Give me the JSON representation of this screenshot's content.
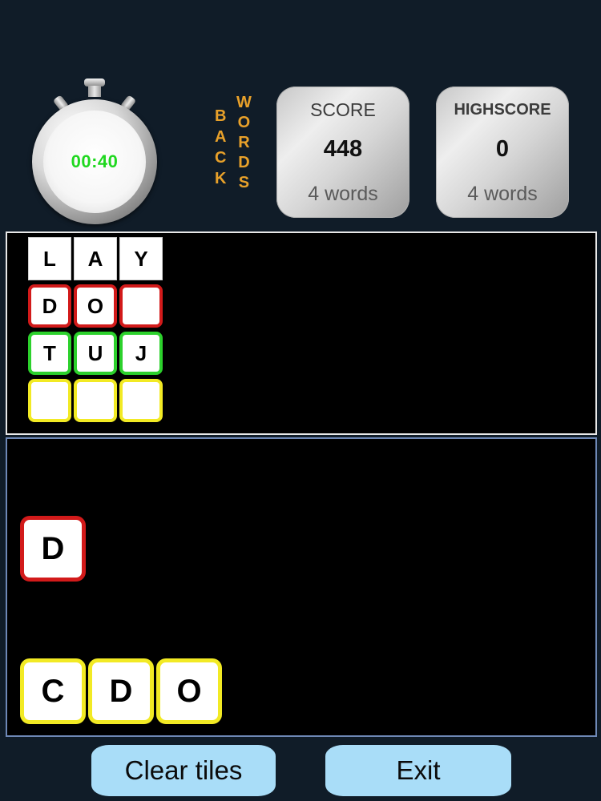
{
  "timer": {
    "time": "00:40"
  },
  "title": {
    "back": [
      "B",
      "A",
      "C",
      "K"
    ],
    "words": [
      "W",
      "O",
      "R",
      "D",
      "S"
    ]
  },
  "score_card": {
    "label": "SCORE",
    "value": "448",
    "words": "4 words"
  },
  "highscore_card": {
    "label": "HIGHSCORE",
    "value": "0",
    "words": "4 words"
  },
  "word_grid": {
    "rows": [
      {
        "style": "white",
        "cells": [
          "L",
          "A",
          "Y"
        ]
      },
      {
        "style": "red",
        "cells": [
          "D",
          "O",
          ""
        ]
      },
      {
        "style": "green",
        "cells": [
          "T",
          "U",
          "J"
        ]
      },
      {
        "style": "yellow",
        "cells": [
          "",
          "",
          ""
        ]
      }
    ]
  },
  "tiles": {
    "single": {
      "letter": "D",
      "style": "red"
    },
    "row": [
      {
        "letter": "C",
        "style": "yellow"
      },
      {
        "letter": "D",
        "style": "yellow"
      },
      {
        "letter": "O",
        "style": "yellow"
      }
    ]
  },
  "buttons": {
    "clear": "Clear tiles",
    "exit": "Exit"
  },
  "colors": {
    "accent_title": "#e8a12a",
    "timer_text": "#1fd81f",
    "button_bg": "#a9ddf8",
    "red_border": "#d21a1a",
    "green_border": "#2cd12c",
    "yellow_border": "#f2ea24"
  }
}
